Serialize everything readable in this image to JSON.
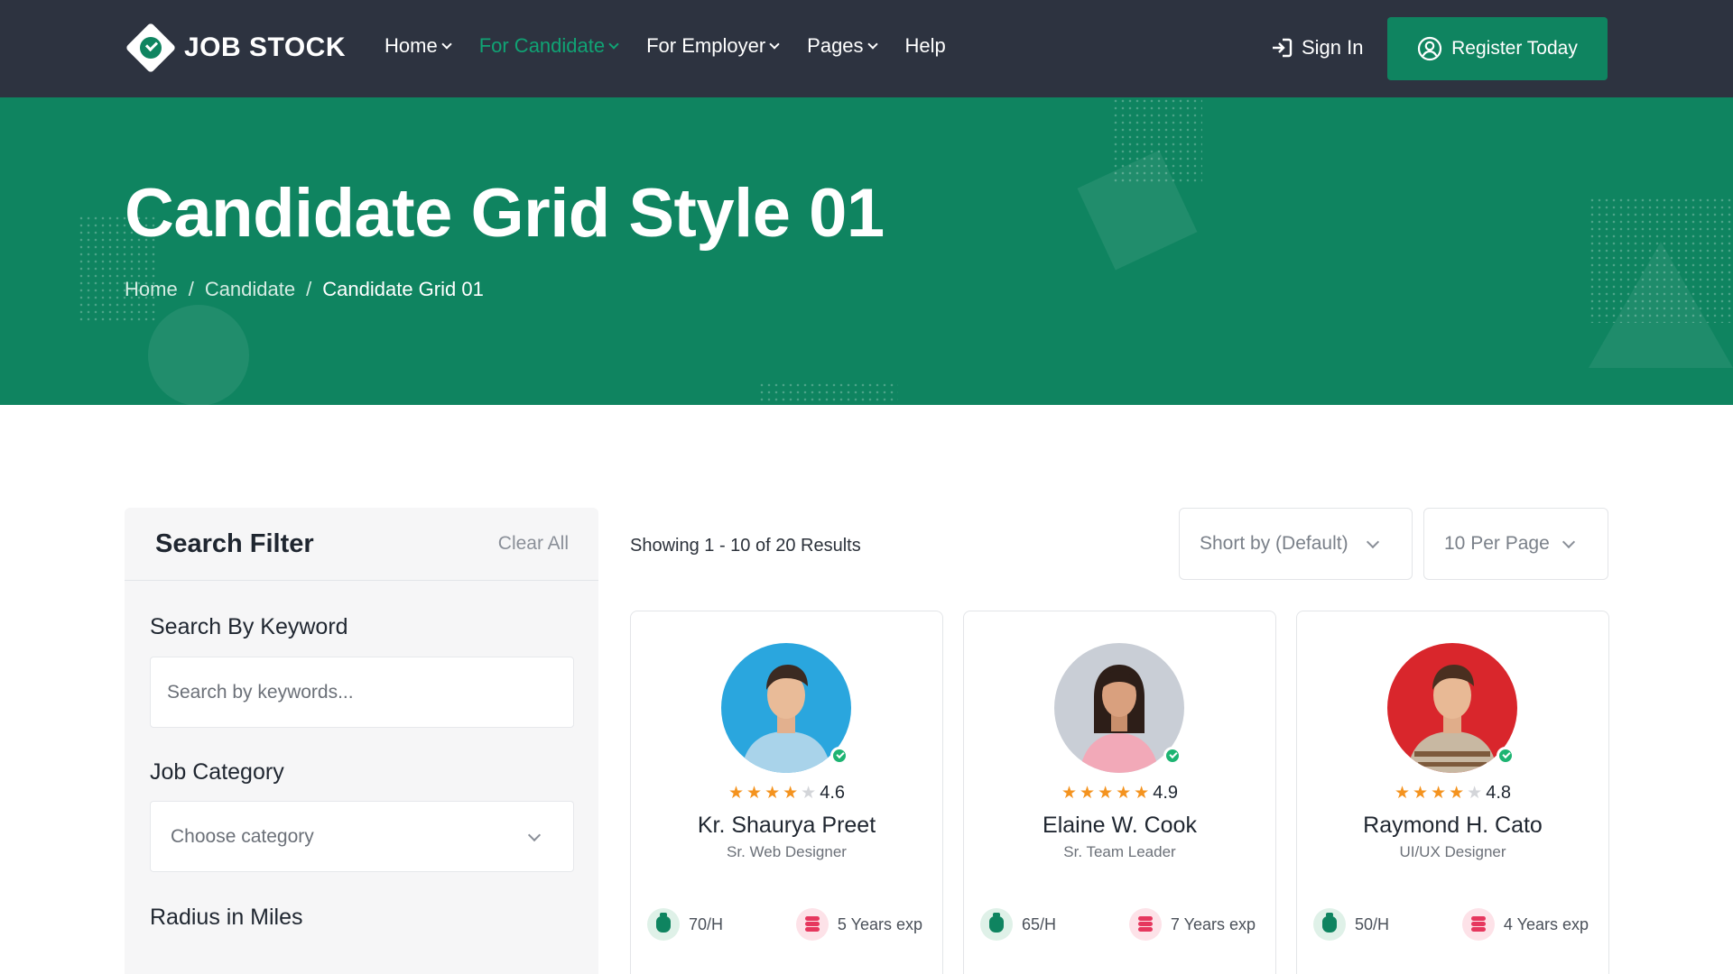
{
  "brand": {
    "name": "JOB STOCK"
  },
  "nav": [
    {
      "label": "Home",
      "has_dropdown": true,
      "active": false
    },
    {
      "label": "For Candidate",
      "has_dropdown": true,
      "active": true
    },
    {
      "label": "For Employer",
      "has_dropdown": true,
      "active": false
    },
    {
      "label": "Pages",
      "has_dropdown": true,
      "active": false
    },
    {
      "label": "Help",
      "has_dropdown": false,
      "active": false
    }
  ],
  "header_actions": {
    "signin": "Sign In",
    "register": "Register Today"
  },
  "hero": {
    "title": "Candidate Grid Style 01",
    "breadcrumb": [
      "Home",
      "Candidate",
      "Candidate Grid 01"
    ],
    "separator": "/"
  },
  "filter": {
    "title": "Search Filter",
    "clear": "Clear All",
    "keyword_label": "Search By Keyword",
    "keyword_placeholder": "Search by keywords...",
    "category_label": "Job Category",
    "category_value": "Choose category",
    "radius_label": "Radius in Miles"
  },
  "results": {
    "showing": "Showing 1 - 10 of 20 Results",
    "sort": "Short by (Default)",
    "per_page": "10 Per Page"
  },
  "candidates": [
    {
      "name": "Kr. Shaurya Preet",
      "role": "Sr. Web Designer",
      "rating": "4.6",
      "stars": 4,
      "rate": "70/H",
      "experience": "5 Years exp",
      "avatar_bg": "#2aa6de"
    },
    {
      "name": "Elaine W. Cook",
      "role": "Sr. Team Leader",
      "rating": "4.9",
      "stars": 5,
      "rate": "65/H",
      "experience": "7 Years exp",
      "avatar_bg": "#c9ced6"
    },
    {
      "name": "Raymond H. Cato",
      "role": "UI/UX Designer",
      "rating": "4.8",
      "stars": 4,
      "rate": "50/H",
      "experience": "4 Years exp",
      "avatar_bg": "#d9262c"
    }
  ],
  "colors": {
    "primary": "#0f8460",
    "header_bg": "#2d3340",
    "nav_active": "#10a374",
    "star": "#f4931f"
  }
}
